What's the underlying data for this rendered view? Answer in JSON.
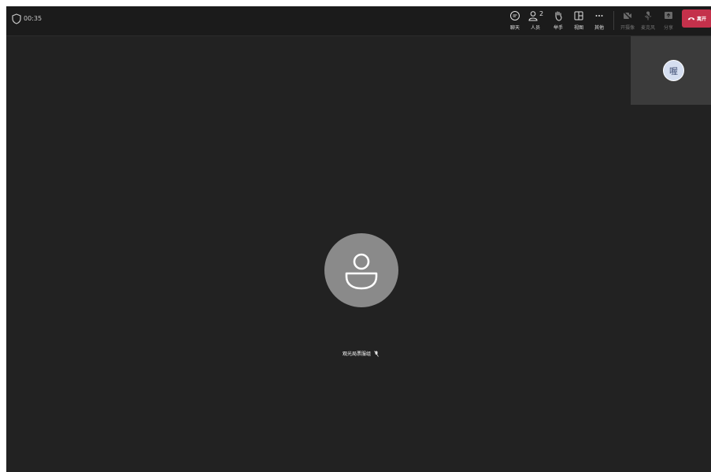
{
  "call": {
    "timer": "00:35"
  },
  "toolbar": {
    "chat_label": "聊天",
    "people_label": "人员",
    "people_count": "2",
    "raise_hand_label": "举手",
    "view_label": "视图",
    "more_label": "其他",
    "camera_label": "开摄像",
    "mic_label": "麦克风",
    "share_label": "分享",
    "leave_label": "离开"
  },
  "self_view": {
    "initial": "喔"
  },
  "participant": {
    "name": "观光局票服组"
  },
  "colors": {
    "stage_background": "#222222",
    "toolbar_background": "#1b1b1b",
    "leave_button": "#c4314b",
    "avatar_gray": "#8a8a8a",
    "self_avatar": "#d5def0"
  },
  "icons": [
    "shield-icon",
    "chat-icon",
    "people-icon",
    "raise-hand-icon",
    "view-icon",
    "more-icon",
    "camera-icon",
    "mic-icon",
    "share-icon",
    "phone-icon",
    "person-icon",
    "mic-off-icon"
  ]
}
